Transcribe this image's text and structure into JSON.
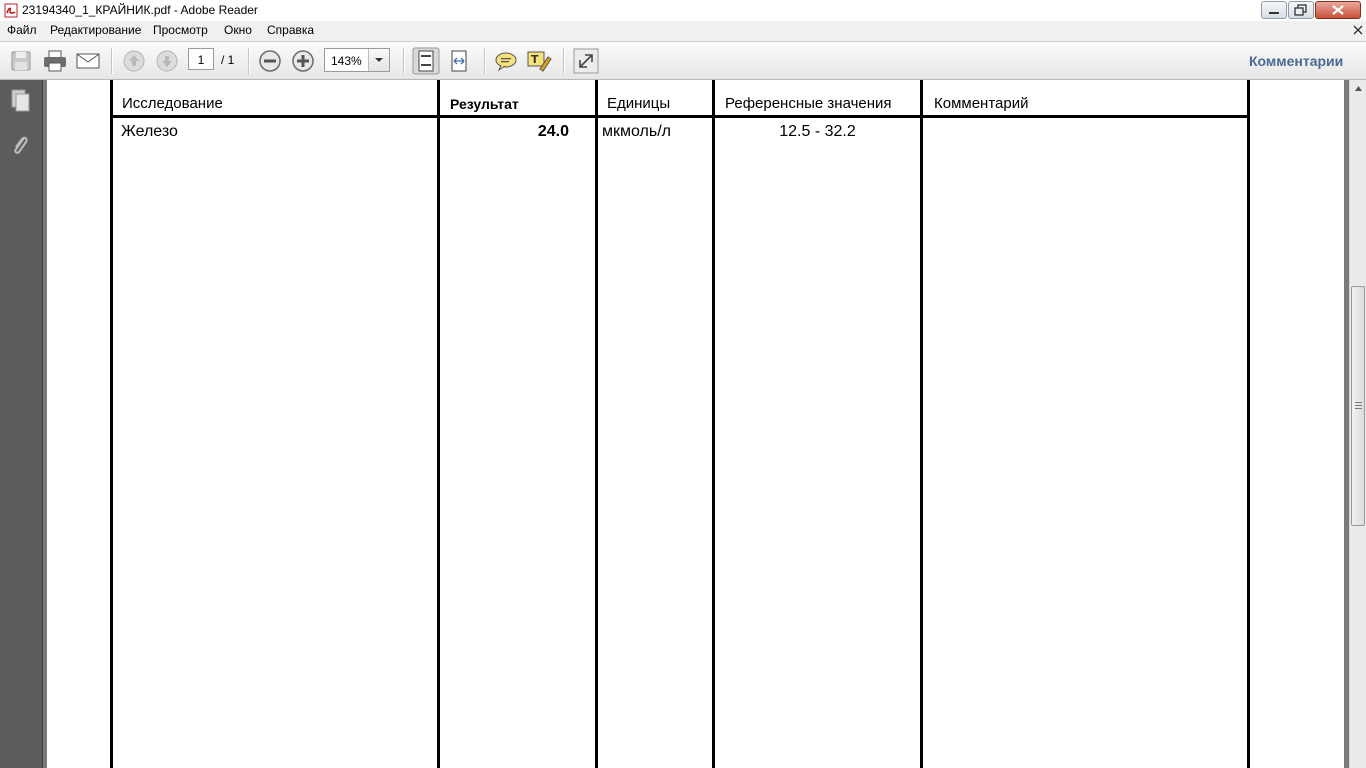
{
  "window": {
    "title": "23194340_1_КРАЙНИК.pdf - Adobe Reader"
  },
  "menu": {
    "items": [
      "Файл",
      "Редактирование",
      "Просмотр",
      "Окно",
      "Справка"
    ]
  },
  "toolbar": {
    "page_current": "1",
    "page_total": "/ 1",
    "zoom": "143%",
    "comments_label": "Комментарии",
    "icons": [
      "save-icon",
      "print-icon",
      "email-icon",
      "prev-page-icon",
      "next-page-icon",
      "zoom-out-icon",
      "zoom-in-icon",
      "fit-page-icon",
      "fit-width-icon",
      "comment-icon",
      "highlight-icon",
      "expand-icon"
    ]
  },
  "navpane": {
    "icons": [
      "pages-icon",
      "attachments-icon"
    ]
  },
  "document": {
    "table": {
      "headers": [
        "Исследование",
        "Результат",
        "Единицы",
        "Референсные значения",
        "Комментарий"
      ],
      "rows": [
        {
          "test": "Железо",
          "result": "24.0",
          "units": "мкмоль/л",
          "reference": "12.5 - 32.2",
          "comment": ""
        }
      ]
    }
  }
}
